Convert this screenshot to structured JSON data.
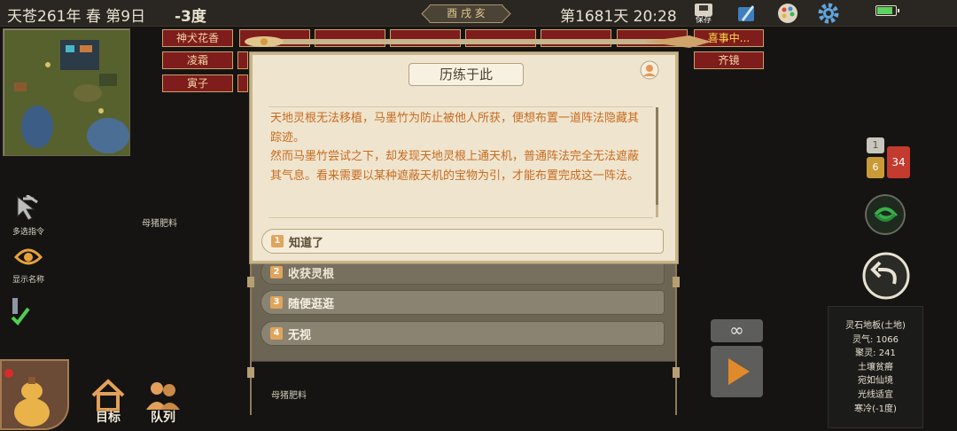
{
  "topbar": {
    "date": "天苍261年 春 第9日",
    "temperature": "-3度",
    "season_badge": "酉 戌 亥",
    "day_time": "第1681天 20:28",
    "save_label": "保存",
    "battery_level": 0.85
  },
  "tools": {
    "multi_select": "多选指令",
    "show_names": "显示名称"
  },
  "ground_labels": [
    "母猪肥料",
    "母猪肥料"
  ],
  "tags": [
    "神犬花香",
    "凌霜",
    "寅子",
    "齐镜",
    "喜事中..."
  ],
  "dialog": {
    "title": "历练于此",
    "paragraphs": [
      "天地灵根无法移植，马墨竹为防止被他人所获，便想布置一道阵法隐藏其踪迹。",
      "然而马墨竹尝试之下，却发现天地灵根上通天机，普通阵法完全无法遮蔽其气息。看来需要以某种遮蔽天机的宝物为引，才能布置完成这一阵法。"
    ],
    "options": [
      {
        "num": "1",
        "label": "知道了"
      },
      {
        "num": "2",
        "label": "收获灵根"
      },
      {
        "num": "3",
        "label": "随便逛逛"
      },
      {
        "num": "4",
        "label": "无视"
      }
    ]
  },
  "messages": {
    "count_a": "1",
    "count_b": "6",
    "count_c": "34"
  },
  "loop_symbol": "∞",
  "info_panel": {
    "lines": [
      "灵石地板(土地)",
      "灵气: 1066",
      "聚灵: 241",
      "土壤贫瘠",
      "宛如仙境",
      "光线适宜",
      "寒冷(-1度)"
    ]
  },
  "bottom": {
    "target": "目标",
    "queue": "队列"
  }
}
